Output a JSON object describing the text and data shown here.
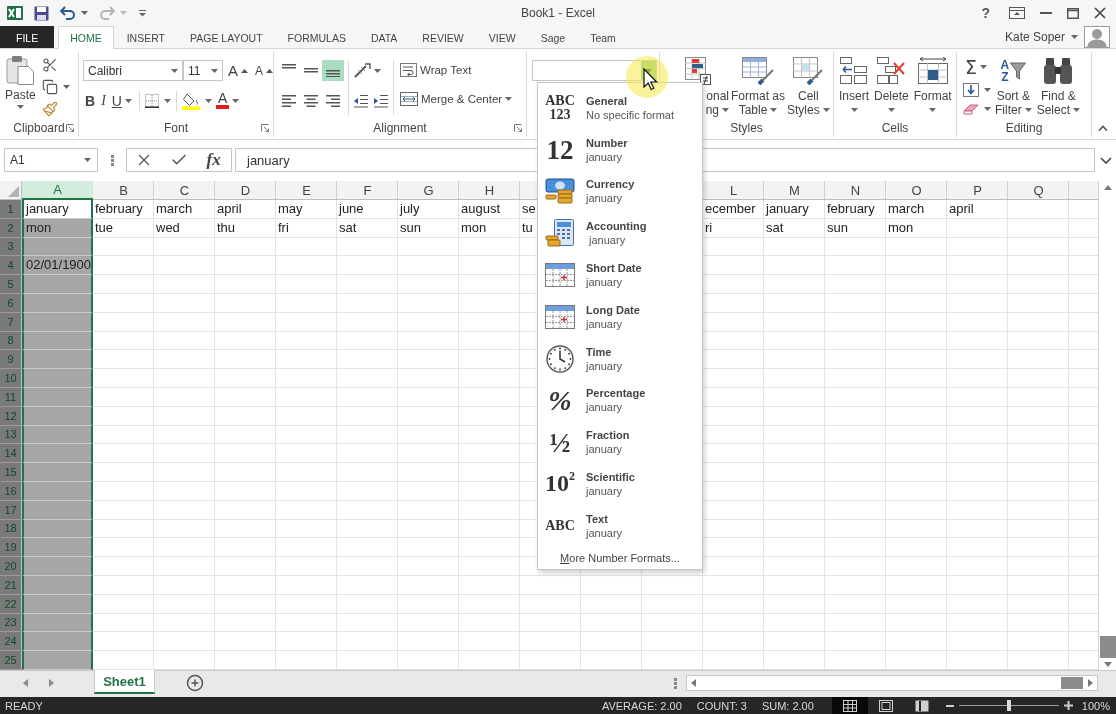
{
  "window": {
    "title": "Book1 - Excel",
    "help": "?"
  },
  "quick_access": [
    {
      "kind": "save",
      "disabled": false
    },
    {
      "kind": "undo",
      "disabled": false
    },
    {
      "kind": "redo",
      "disabled": true
    }
  ],
  "tabs": [
    {
      "label": "FILE",
      "kind": "backstage",
      "selected": false
    },
    {
      "label": "HOME",
      "kind": "tab",
      "selected": true
    },
    {
      "label": "INSERT",
      "kind": "tab",
      "selected": false
    },
    {
      "label": "PAGE LAYOUT",
      "kind": "tab",
      "selected": false
    },
    {
      "label": "FORMULAS",
      "kind": "tab",
      "selected": false
    },
    {
      "label": "DATA",
      "kind": "tab",
      "selected": false
    },
    {
      "label": "REVIEW",
      "kind": "tab",
      "selected": false
    },
    {
      "label": "VIEW",
      "kind": "tab",
      "selected": false
    },
    {
      "label": "Sage",
      "kind": "tab",
      "selected": false
    },
    {
      "label": "Team",
      "kind": "tab",
      "selected": false
    }
  ],
  "account": {
    "name": "Kate Soper"
  },
  "ribbon": {
    "clipboard": {
      "label": "Clipboard",
      "paste": "Paste"
    },
    "font": {
      "label": "Font",
      "font_name": "Calibri",
      "font_size": "11",
      "grow": "A",
      "shrink": "A",
      "styles": [
        {
          "kind": "bold",
          "glyph": "B"
        },
        {
          "kind": "italic",
          "glyph": "I"
        },
        {
          "kind": "underline",
          "glyph": "U"
        }
      ],
      "font_color": "A"
    },
    "alignment": {
      "label": "Alignment",
      "vertical": [
        {
          "kind": "top",
          "selected": false
        },
        {
          "kind": "middle",
          "selected": false
        },
        {
          "kind": "bottom",
          "selected": true
        }
      ],
      "horizontal": [
        {
          "kind": "left",
          "selected": false
        },
        {
          "kind": "center",
          "selected": false
        },
        {
          "kind": "right",
          "selected": false
        }
      ],
      "wrap_text": "Wrap Text",
      "merge": "Merge & Center"
    },
    "styles": {
      "label": "Styles",
      "buttons": [
        {
          "kind": "conditional",
          "lines": [
            "onal",
            "ng"
          ]
        },
        {
          "kind": "table",
          "lines": [
            "Format as",
            "Table"
          ]
        },
        {
          "kind": "cell_styles",
          "lines": [
            "Cell",
            "Styles"
          ]
        }
      ]
    },
    "cells": {
      "label": "Cells",
      "buttons": [
        {
          "kind": "insert",
          "label": "Insert"
        },
        {
          "kind": "delete",
          "label": "Delete"
        },
        {
          "kind": "format",
          "label": "Format"
        }
      ]
    },
    "editing": {
      "label": "Editing",
      "sum": "Σ",
      "buttons": [
        {
          "kind": "sort",
          "glyphs": [
            "A",
            "Z"
          ],
          "lines": [
            "Sort &",
            "Filter"
          ]
        },
        {
          "kind": "find",
          "lines": [
            "Find &",
            "Select"
          ]
        }
      ]
    }
  },
  "formula_bar": {
    "name_box": "A1",
    "function": "fx",
    "formula": "january"
  },
  "sheet": {
    "columns": [
      {
        "label": "A",
        "selected": true
      },
      {
        "label": "B",
        "selected": false
      },
      {
        "label": "C",
        "selected": false
      },
      {
        "label": "D",
        "selected": false
      },
      {
        "label": "E",
        "selected": false
      },
      {
        "label": "F",
        "selected": false
      },
      {
        "label": "G",
        "selected": false
      },
      {
        "label": "H",
        "selected": false
      },
      {
        "selected": false
      },
      null,
      null,
      {
        "label": "L",
        "selected": false
      },
      {
        "label": "M",
        "selected": false
      },
      {
        "label": "N",
        "selected": false
      },
      {
        "label": "O",
        "selected": false
      },
      {
        "label": "P",
        "selected": false
      },
      {
        "label": "Q",
        "selected": false
      },
      {
        "selected": false
      }
    ],
    "rows": [
      {
        "number": "1",
        "cells": [
          {
            "text": "january",
            "active": true
          },
          {
            "text": "february",
            "active": false
          },
          {
            "text": "march",
            "active": false
          },
          {
            "text": "april",
            "active": false
          },
          {
            "text": "may",
            "active": false
          },
          {
            "text": "june",
            "active": false
          },
          {
            "text": "july",
            "active": false
          },
          {
            "text": "august",
            "active": false
          },
          {
            "text": "se",
            "active": false
          },
          null,
          null,
          {
            "text": "ecember",
            "active": false
          },
          {
            "text": "january",
            "active": false
          },
          {
            "text": "february",
            "active": false
          },
          {
            "text": "march",
            "active": false
          },
          {
            "text": "april",
            "active": false
          }
        ]
      },
      {
        "number": "2",
        "cells": [
          {
            "text": "mon",
            "active": false
          },
          {
            "text": "tue",
            "active": false
          },
          {
            "text": "wed",
            "active": false
          },
          {
            "text": "thu",
            "active": false
          },
          {
            "text": "fri",
            "active": false
          },
          {
            "text": "sat",
            "active": false
          },
          {
            "text": "sun",
            "active": false
          },
          {
            "text": "mon",
            "active": false
          },
          {
            "text": "tu",
            "active": false
          },
          null,
          null,
          {
            "text": "ri",
            "active": false
          },
          {
            "text": "sat",
            "active": false
          },
          {
            "text": "sun",
            "active": false
          },
          {
            "text": "mon",
            "active": false
          }
        ]
      },
      {
        "number": "3"
      },
      {
        "number": "4",
        "cells": [
          {
            "text": "02/01/1900",
            "active": false
          }
        ]
      },
      {
        "number": "5"
      },
      {
        "number": "6"
      },
      {
        "number": "7"
      },
      {
        "number": "8"
      },
      {
        "number": "9"
      },
      {
        "number": "10"
      },
      {
        "number": "11"
      },
      {
        "number": "12"
      },
      {
        "number": "13"
      },
      {
        "number": "14"
      },
      {
        "number": "15"
      },
      {
        "number": "16"
      },
      {
        "number": "17"
      },
      {
        "number": "18"
      },
      {
        "number": "19"
      },
      {
        "number": "20"
      },
      {
        "number": "21"
      },
      {
        "number": "22"
      },
      {
        "number": "23"
      },
      {
        "number": "24"
      },
      {
        "number": "25"
      }
    ]
  },
  "number_format_menu": {
    "items": [
      {
        "kind": "general",
        "glyph": [
          "ABC",
          "123"
        ],
        "label": "General",
        "sample": "No specific format"
      },
      {
        "kind": "number",
        "glyph": [
          "12"
        ],
        "label": "Number",
        "sample": "january"
      },
      {
        "kind": "currency",
        "label": "Currency",
        "sample": "january"
      },
      {
        "kind": "accounting",
        "label": "Accounting",
        "sample": " january"
      },
      {
        "kind": "short_date",
        "label": "Short Date",
        "sample": "january"
      },
      {
        "kind": "long_date",
        "label": "Long Date",
        "sample": "january"
      },
      {
        "kind": "time",
        "label": "Time",
        "sample": "january"
      },
      {
        "kind": "percentage",
        "glyph": [
          "%"
        ],
        "label": "Percentage",
        "sample": "january"
      },
      {
        "kind": "fraction",
        "glyph": [
          "½"
        ],
        "label": "Fraction",
        "sample": "january"
      },
      {
        "kind": "scientific",
        "glyph": [
          "10$^{2}$"
        ],
        "label": "Scientific",
        "sample": "january"
      },
      {
        "kind": "text",
        "glyph": [
          "ABC"
        ],
        "label": "Text",
        "sample": "january"
      }
    ],
    "footer": "More Number Formats..."
  },
  "sheet_tabs": [
    {
      "label": "Sheet1",
      "selected": true
    }
  ],
  "status_bar": {
    "mode": "READY",
    "stats": [
      "AVERAGE: 2.00",
      "COUNT: 3",
      "SUM: 2.00"
    ],
    "views": [
      {
        "kind": "normal",
        "selected": true
      },
      {
        "kind": "page_layout",
        "selected": false
      },
      {
        "kind": "page_break",
        "selected": false
      }
    ],
    "zoom": {
      "level": 0.5,
      "reading": "100%"
    }
  }
}
